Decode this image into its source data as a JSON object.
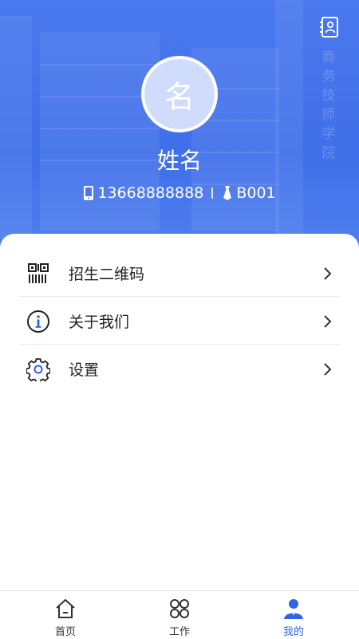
{
  "header": {
    "watermark_text": "商务技师学院",
    "avatar_char": "名",
    "name": "姓名",
    "phone": "13668888888",
    "employee_id": "B001",
    "icons": {
      "contact": "contact-card-icon",
      "phone": "phone-icon",
      "id": "tie-icon"
    }
  },
  "menu": {
    "items": [
      {
        "label": "招生二维码",
        "icon": "qr-code-icon"
      },
      {
        "label": "关于我们",
        "icon": "info-icon"
      },
      {
        "label": "设置",
        "icon": "gear-icon"
      }
    ]
  },
  "tabs": [
    {
      "label": "首页",
      "icon": "home-icon",
      "active": false
    },
    {
      "label": "工作",
      "icon": "work-grid-icon",
      "active": false
    },
    {
      "label": "我的",
      "icon": "profile-icon",
      "active": true
    }
  ],
  "colors": {
    "header_blue": "#4a78ee",
    "accent": "#2f64e6",
    "text": "#222222"
  }
}
